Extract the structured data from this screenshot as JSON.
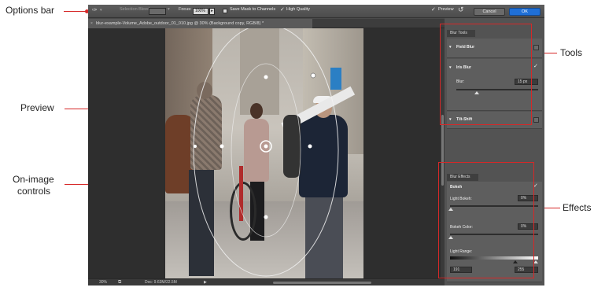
{
  "annotations": {
    "options_bar": "Options bar",
    "preview": "Preview",
    "on_image_controls_line1": "On-image",
    "on_image_controls_line2": "controls",
    "tools": "Tools",
    "effects": "Effects"
  },
  "options_bar": {
    "selection_bleed_label": "Selection Bleed:",
    "selection_bleed_value": "",
    "focus_label": "Focus:",
    "focus_value": "100%",
    "save_mask_label": "Save Mask to Channels",
    "high_quality_label": "High Quality",
    "preview_label": "Preview",
    "cancel_label": "Cancel",
    "ok_label": "OK"
  },
  "document_tab": {
    "title": "blur-example-Volume_Adobe_outdoor_01_010.jpg @ 30% (Background copy, RGB/8) *"
  },
  "status_bar": {
    "zoom": "30%",
    "doc_info": "Doc: 9.63M/22.5M"
  },
  "blur_tools": {
    "header": "Blur Tools",
    "field_blur": "Field Blur",
    "iris_blur": "Iris Blur",
    "blur_label": "Blur:",
    "blur_value": "15 px",
    "tilt_shift": "Tilt-Shift"
  },
  "blur_effects": {
    "header": "Blur Effects",
    "bokeh": "Bokeh",
    "light_bokeh_label": "Light Bokeh:",
    "light_bokeh_value": "0%",
    "bokeh_color_label": "Bokeh Color:",
    "bokeh_color_value": "0%",
    "light_range_label": "Light Range:",
    "light_range_min": "191",
    "light_range_max": "255"
  },
  "colors": {
    "annotation_red": "#d62828",
    "ui_dark": "#4a4a4a",
    "ok_blue": "#1f6fd6"
  }
}
